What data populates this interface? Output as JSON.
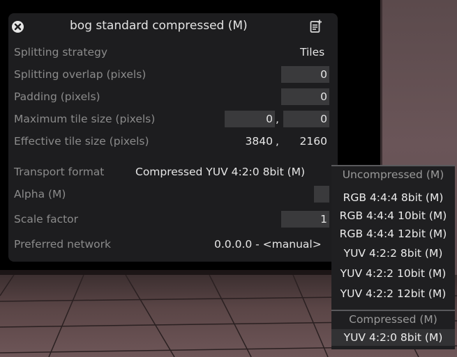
{
  "panel": {
    "title": "bog standard compressed (M)",
    "rows": {
      "splitting_strategy": {
        "label": "Splitting strategy",
        "value": "Tiles"
      },
      "splitting_overlap": {
        "label": "Splitting overlap (pixels)",
        "value": "0"
      },
      "padding": {
        "label": "Padding (pixels)",
        "value": "0"
      },
      "max_tile_size": {
        "label": "Maximum tile size (pixels)",
        "value_w": "0",
        "separator": ",",
        "value_h": "0"
      },
      "effective_tile_size": {
        "label": "Effective tile size (pixels)",
        "value_w": "3840",
        "separator": ",",
        "value_h": "2160"
      },
      "transport_format": {
        "label": "Transport format",
        "value": "Compressed YUV 4:2:0 8bit (M)"
      },
      "alpha": {
        "label": "Alpha (M)",
        "value": ""
      },
      "scale_factor": {
        "label": "Scale factor",
        "value": "1"
      },
      "preferred_network": {
        "label": "Preferred network",
        "value": "0.0.0.0 - <manual>"
      }
    }
  },
  "dropdown": {
    "group_uncompressed": "Uncompressed (M)",
    "uncompressed_options": [
      "RGB 4:4:4 8bit (M)",
      "RGB 4:4:4 10bit (M)",
      "RGB 4:4:4 12bit (M)",
      "YUV 4:2:2 8bit (M)",
      "YUV 4:2:2 10bit (M)",
      "YUV 4:2:2 12bit (M)"
    ],
    "group_compressed": "Compressed (M)",
    "compressed_options": [
      "YUV 4:2:0 8bit (M)"
    ]
  },
  "icons": {
    "close": "close-circle-icon",
    "doc": "document-add-icon"
  },
  "colors": {
    "panel_bg": "#1d1d1f",
    "field_bg": "#3a3a3c",
    "label": "#8b8b8b",
    "text": "#e6e6e6"
  }
}
